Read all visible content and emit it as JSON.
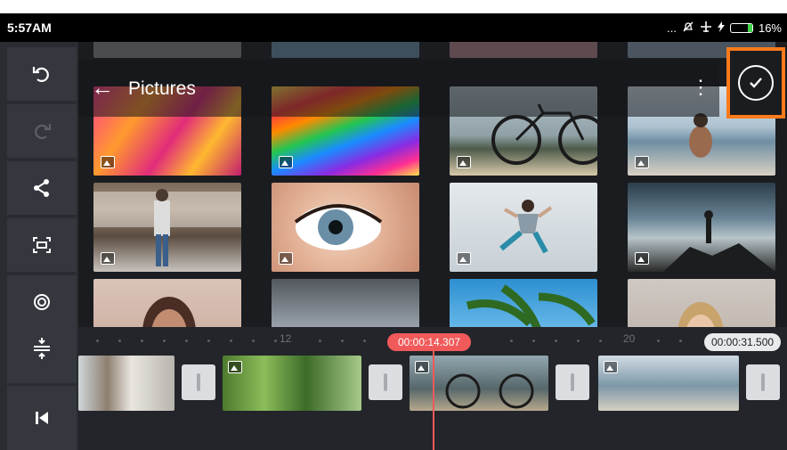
{
  "status_bar": {
    "time": "5:57AM",
    "more_glyph": "...",
    "battery": "16%",
    "icons": [
      "notifications-off-icon",
      "airplane-mode-icon",
      "charging-icon",
      "battery-icon"
    ]
  },
  "left_tools": [
    {
      "name": "undo-icon",
      "glyph": "⟲",
      "enabled": true
    },
    {
      "name": "redo-icon",
      "glyph": "⟳",
      "enabled": false
    },
    {
      "name": "share-icon",
      "glyph": "<",
      "enabled": true
    },
    {
      "name": "capture-frame-icon",
      "glyph": "⛶",
      "enabled": true
    },
    {
      "name": "settings-circle-icon",
      "glyph": "◎",
      "enabled": true
    }
  ],
  "timeline_tools": [
    {
      "name": "split-layers-icon",
      "glyph": "⇟"
    },
    {
      "name": "jump-to-start-icon",
      "glyph": "I◀"
    }
  ],
  "appbar": {
    "back_icon": "←",
    "title": "Pictures",
    "menu_icon": "⋮"
  },
  "confirm_icon": "check-circle-icon",
  "timeline": {
    "ruler_labels": [
      "12",
      "20"
    ],
    "current_time": "00:00:14.307",
    "total_time": "00:00:31.500"
  },
  "colors": {
    "accent_highlight": "#ff7a1a",
    "playhead": "#f05a5a",
    "toolbar_bg": "#2a2c31",
    "tool_bg": "#34373d"
  }
}
